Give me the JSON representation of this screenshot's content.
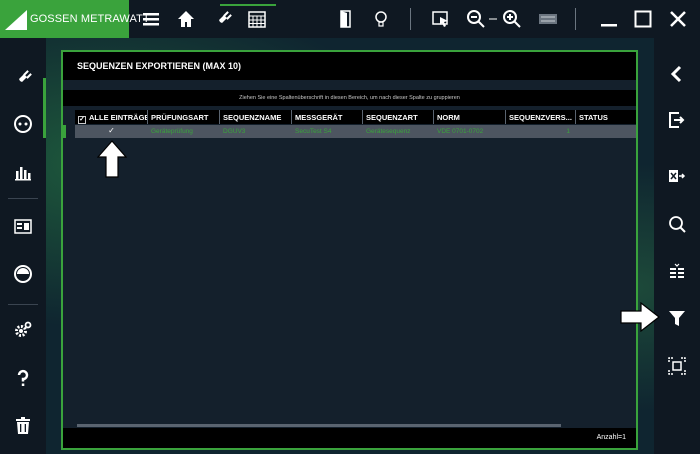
{
  "brand": {
    "name": "GOSSEN METRAWATT",
    "color": "#3aa33c"
  },
  "topbar": {
    "icons": [
      "menu-icon",
      "home-icon",
      "plug-icon",
      "calendar-icon",
      "door-icon",
      "bulb-icon",
      "cursor-select-icon",
      "zoom-out-icon",
      "zoom-in-icon",
      "keyboard-icon",
      "minimize-icon",
      "maximize-icon",
      "close-icon"
    ]
  },
  "dialog": {
    "title": "SEQUENZEN EXPORTIEREN (MAX 10)",
    "group_hint": "Ziehen Sie eine Spaltenüberschrift in diesen Bereich, um nach dieser Spalte zu gruppieren",
    "columns": [
      "ALLE EINTRÄGE",
      "PRÜFUNGSART",
      "SEQUENZNAME",
      "MESSGERÄT",
      "SEQUENZART",
      "NORM",
      "SEQUENZVERS...",
      "STATUS"
    ],
    "rows": [
      {
        "checked": "✓",
        "pruefungsart": "Geräteprüfung",
        "sequenzname": "DGUV3",
        "messgeraet": "SecuTest S4",
        "sequenzart": "Gerätesequenz",
        "norm": "VDE 0701-0702",
        "version": "1",
        "status": ""
      }
    ],
    "count": "Anzahl=1"
  }
}
